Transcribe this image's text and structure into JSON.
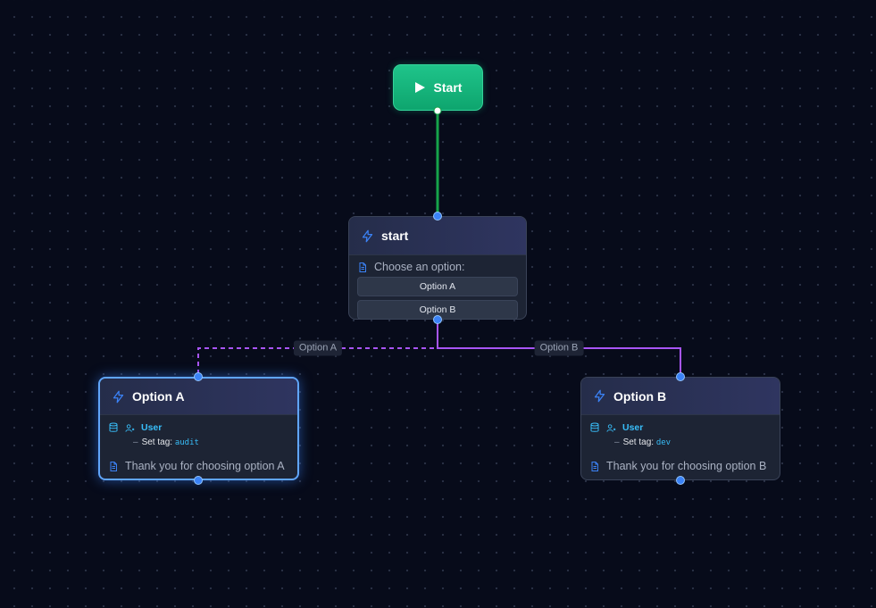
{
  "start": {
    "label": "Start"
  },
  "nodes": {
    "start": {
      "title": "start",
      "message": "Choose an option:",
      "buttons": [
        "Option A",
        "Option B"
      ]
    },
    "option_a": {
      "title": "Option A",
      "action_label": "User",
      "tag_prefix": "Set tag:",
      "tag_value": "audit",
      "message": "Thank you for choosing option A"
    },
    "option_b": {
      "title": "Option B",
      "action_label": "User",
      "tag_prefix": "Set tag:",
      "tag_value": "dev",
      "message": "Thank you for choosing option B"
    }
  },
  "edges": {
    "to_option_a": "Option A",
    "to_option_b": "Option B"
  },
  "colors": {
    "start_edge": "#16a34a",
    "option_a_edge": "#a855f7",
    "option_b_edge": "#a855f7",
    "accent": "#3b82f6"
  }
}
